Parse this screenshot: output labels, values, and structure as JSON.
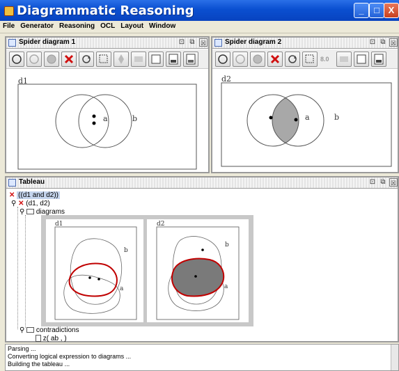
{
  "window": {
    "title": "Diagrammatic Reasoning",
    "minimize": "_",
    "maximize": "□",
    "close": "X"
  },
  "menu": [
    "File",
    "Generator",
    "Reasoning",
    "OCL",
    "Layout",
    "Window"
  ],
  "spider1": {
    "title": "Spider diagram 1",
    "diagram_name": "d1",
    "label_a": "a",
    "label_b": "b"
  },
  "spider2": {
    "title": "Spider diagram 2",
    "diagram_name": "d2",
    "label_a": "a",
    "label_b": "b",
    "zoom_label": "8.0"
  },
  "tableau": {
    "title": "Tableau",
    "nodes": [
      "((d1 and d2))",
      "(d1, d2)",
      "diagrams",
      "contradictions",
      "z( ab , )"
    ],
    "d1": "d1",
    "d2": "d2",
    "label_a": "a",
    "label_b": "b"
  },
  "frame_controls": {
    "restore": "⊡",
    "max": "⧉",
    "close": "☒"
  },
  "console": {
    "lines": [
      "Parsing ...",
      "Converting logical expression to diagrams ...",
      "Building the tableau ..."
    ]
  },
  "colors": {
    "shade": "#a8a8a8",
    "dark_shade": "#7a7a7a",
    "red_outline": "#c00000",
    "cross": "#d01010"
  }
}
